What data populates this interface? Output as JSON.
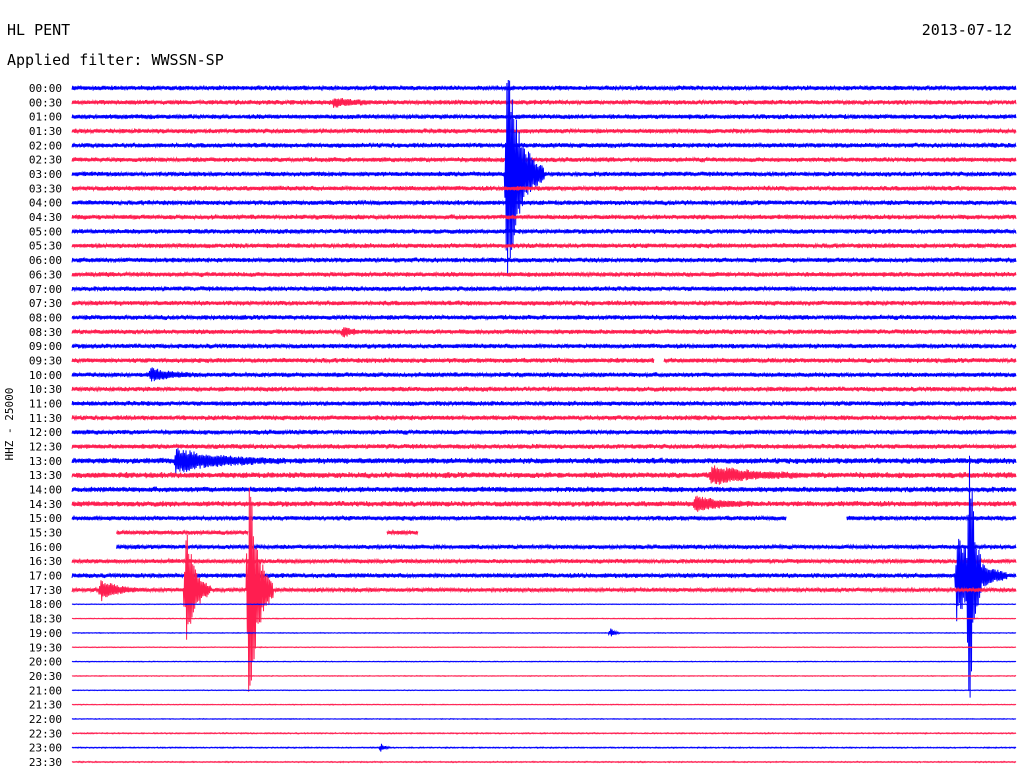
{
  "header": {
    "station": "HL PENT",
    "date": "2013-07-12",
    "filter": "Applied filter: WWSSN-SP"
  },
  "chart_data": {
    "type": "line",
    "title": "HL PENT",
    "ylabel": "HHZ - 25000",
    "line_labels": [
      "00:00",
      "00:30",
      "01:00",
      "01:30",
      "02:00",
      "02:30",
      "03:00",
      "03:30",
      "04:00",
      "04:30",
      "05:00",
      "05:30",
      "06:00",
      "06:30",
      "07:00",
      "07:30",
      "08:00",
      "08:30",
      "09:00",
      "09:30",
      "10:00",
      "10:30",
      "11:00",
      "11:30",
      "12:00",
      "12:30",
      "13:00",
      "13:30",
      "14:00",
      "14:30",
      "15:00",
      "15:30",
      "16:00",
      "16:30",
      "17:00",
      "17:30",
      "18:00",
      "18:30",
      "19:00",
      "19:30",
      "20:00",
      "20:30",
      "21:00",
      "21:30",
      "22:00",
      "22:30",
      "23:00",
      "23:30"
    ],
    "line_minutes": 30,
    "colors": [
      "#0000ff",
      "#ff1e50"
    ],
    "noise_amplitude": [
      2.6,
      2.6,
      2.6,
      2.6,
      2.6,
      2.6,
      2.6,
      2.6,
      2.6,
      2.6,
      2.6,
      2.6,
      2.6,
      2.6,
      2.6,
      2.6,
      2.6,
      2.6,
      2.6,
      2.6,
      2.6,
      2.6,
      2.6,
      2.6,
      2.6,
      2.6,
      3.2,
      3.2,
      3,
      3,
      2.6,
      2.4,
      2.4,
      2.4,
      2.6,
      2.2,
      0.4,
      0.4,
      0.4,
      0.4,
      0.4,
      0.4,
      0.4,
      0.4,
      0.4,
      0.6,
      0.6,
      0.6
    ],
    "events": [
      {
        "line": 1,
        "minute": 8.3,
        "amplitude": 4,
        "duration": 1.5
      },
      {
        "line": 6,
        "minute": 13.8,
        "amplitude": 120,
        "duration": 1.2
      },
      {
        "line": 17,
        "minute": 8.6,
        "amplitude": 6,
        "duration": 0.6
      },
      {
        "line": 20,
        "minute": 2.5,
        "amplitude": 6,
        "duration": 1.5
      },
      {
        "line": 26,
        "minute": 3.3,
        "amplitude": 11,
        "duration": 3.5
      },
      {
        "line": 27,
        "minute": 20.3,
        "amplitude": 9,
        "duration": 3
      },
      {
        "line": 29,
        "minute": 19.8,
        "amplitude": 7,
        "duration": 2
      },
      {
        "line": 35,
        "minute": 0.9,
        "amplitude": 10,
        "duration": 1.4
      },
      {
        "line": 35,
        "minute": 3.6,
        "amplitude": 70,
        "duration": 0.8
      },
      {
        "line": 35,
        "minute": 5.6,
        "amplitude": 140,
        "duration": 0.8
      },
      {
        "line": 34,
        "minute": 28.1,
        "amplitude": 48,
        "duration": 1.6
      },
      {
        "line": 34,
        "minute": 28.5,
        "amplitude": 150,
        "duration": 0.4
      },
      {
        "line": 38,
        "minute": 17.1,
        "amplitude": 6,
        "duration": 0.3
      },
      {
        "line": 46,
        "minute": 9.8,
        "amplitude": 5,
        "duration": 0.3
      }
    ],
    "gaps": [
      {
        "line": 19,
        "start": 18.5,
        "end": 18.8
      },
      {
        "line": 30,
        "start": 22.7,
        "end": 24.6
      },
      {
        "line": 31,
        "start": 0,
        "end": 1.4
      },
      {
        "line": 31,
        "start": 5.6,
        "end": 10.0
      },
      {
        "line": 31,
        "start": 11.0,
        "end": 30
      },
      {
        "line": 32,
        "start": 0,
        "end": 1.4
      }
    ]
  }
}
